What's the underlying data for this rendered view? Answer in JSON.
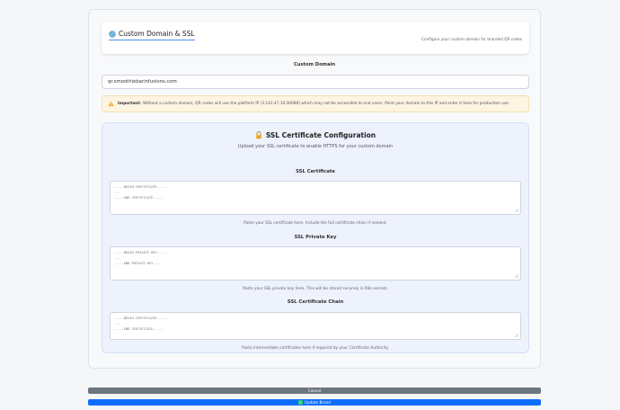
{
  "header": {
    "title": "Custom Domain & SSL",
    "subtitle": "Configure your custom domain for branded QR codes"
  },
  "domain": {
    "label": "Custom Domain",
    "value": "qr.smoothiebarinfusions.com"
  },
  "warning": {
    "strong": "Important:",
    "text": "Without a custom domain, QR codes will use the platform IP (3.141.47.10:30080) which may not be accessible to end users. Point your domain to this IP and enter it here for production use."
  },
  "ssl": {
    "title": "SSL Certificate Configuration",
    "subtitle": "Upload your SSL certificate to enable HTTPS for your custom domain",
    "certificate": {
      "label": "SSL Certificate",
      "placeholder": "-----BEGIN CERTIFICATE-----\n...\n-----END CERTIFICATE-----",
      "help": "Paste your SSL certificate here. Include the full certificate chain if needed."
    },
    "private_key": {
      "label": "SSL Private Key",
      "placeholder": "-----BEGIN PRIVATE KEY-----\n...\n-----END PRIVATE KEY-----",
      "help": "Paste your SSL private key here. This will be stored securely in K8s secrets."
    },
    "chain": {
      "label": "SSL Certificate Chain",
      "placeholder": "-----BEGIN CERTIFICATE-----\n...\n-----END CERTIFICATE-----",
      "help": "Paste intermediate certificates here if required by your Certificate Authority."
    }
  },
  "buttons": {
    "cancel": "Cancel",
    "update": "Update Brand"
  }
}
